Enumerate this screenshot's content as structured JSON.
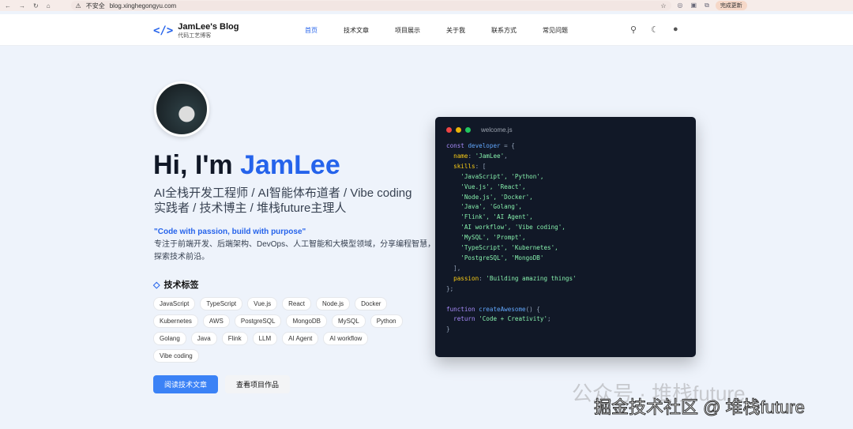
{
  "browser": {
    "insecure": "不安全",
    "url": "blog.xinghegongyu.com",
    "update": "完成更新"
  },
  "header": {
    "logo_icon": "</>",
    "title": "JamLee's Blog",
    "subtitle": "代码工艺博客",
    "menu": [
      "首页",
      "技术文章",
      "项目展示",
      "关于我",
      "联系方式",
      "常见问题"
    ]
  },
  "hero": {
    "greeting": "Hi, I'm ",
    "name": "JamLee",
    "subtitle": "AI全栈开发工程师 / AI智能体布道者 / Vibe coding实践者 / 技术博主 / 堆栈future主理人",
    "quote": "\"Code with passion, build with purpose\"",
    "description": "专注于前端开发、后端架构、DevOps、人工智能和大模型领域，分享编程智慧，探索技术前沿。",
    "tags_title": "技术标签",
    "tags": [
      "JavaScript",
      "TypeScript",
      "Vue.js",
      "React",
      "Node.js",
      "Docker",
      "Kubernetes",
      "AWS",
      "PostgreSQL",
      "MongoDB",
      "MySQL",
      "Python",
      "Golang",
      "Java",
      "Flink",
      "LLM",
      "AI Agent",
      "AI workflow",
      "Vibe coding"
    ],
    "primary_button": "阅读技术文章",
    "secondary_button": "查看项目作品"
  },
  "code": {
    "filename": "welcome.js",
    "dot_colors": [
      "#ef4444",
      "#eab308",
      "#22c55e"
    ],
    "lines": [
      [
        [
          "kw",
          "const "
        ],
        [
          "id",
          "developer"
        ],
        [
          "pu",
          " = {"
        ]
      ],
      [
        [
          "pr",
          "  name"
        ],
        [
          "pu",
          ": "
        ],
        [
          "st",
          "'JamLee'"
        ],
        [
          "pu",
          ","
        ]
      ],
      [
        [
          "pr",
          "  skills"
        ],
        [
          "pu",
          ": ["
        ]
      ],
      [
        [
          "st",
          "    'JavaScript', 'Python',"
        ]
      ],
      [
        [
          "st",
          "    'Vue.js', 'React',"
        ]
      ],
      [
        [
          "st",
          "    'Node.js', 'Docker',"
        ]
      ],
      [
        [
          "st",
          "    'Java', 'Golang',"
        ]
      ],
      [
        [
          "st",
          "    'Flink', 'AI Agent',"
        ]
      ],
      [
        [
          "st",
          "    'AI workflow', 'Vibe coding',"
        ]
      ],
      [
        [
          "st",
          "    'MySQL', 'Prompt',"
        ]
      ],
      [
        [
          "st",
          "    'TypeScript', 'Kubernetes',"
        ]
      ],
      [
        [
          "st",
          "    'PostgreSQL', 'MongoDB'"
        ]
      ],
      [
        [
          "pu",
          "  ],"
        ]
      ],
      [
        [
          "pr",
          "  passion"
        ],
        [
          "pu",
          ": "
        ],
        [
          "st",
          "'Building amazing things'"
        ]
      ],
      [
        [
          "pu",
          "};"
        ]
      ],
      [
        [
          "pu",
          " "
        ]
      ],
      [
        [
          "kw",
          "function "
        ],
        [
          "id",
          "createAwesome"
        ],
        [
          "pu",
          "() {"
        ]
      ],
      [
        [
          "kw",
          "  return "
        ],
        [
          "st",
          "'Code + Creativity'"
        ],
        [
          "pu",
          ";"
        ]
      ],
      [
        [
          "pu",
          "}"
        ]
      ]
    ]
  },
  "watermark": {
    "wechat": "公众号 · 堆栈future",
    "juejin": "掘金技术社区 @ 堆栈future"
  }
}
